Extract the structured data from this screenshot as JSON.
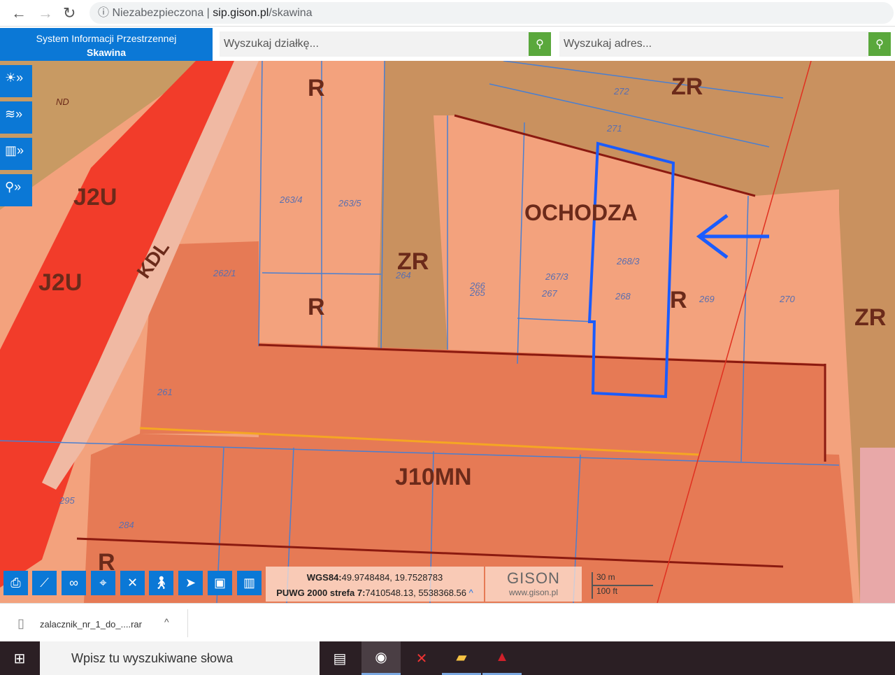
{
  "browser": {
    "security": "Niezabezpieczona",
    "url_host": "sip.gison.pl",
    "url_path": "/skawina"
  },
  "header": {
    "line1": "System Informacji Przestrzennej",
    "line2": "Skawina"
  },
  "search": {
    "parcel_placeholder": "Wyszukaj działkę...",
    "address_placeholder": "Wyszukaj adres..."
  },
  "map": {
    "zone_labels": [
      "R",
      "ZR",
      "J2U",
      "J2U",
      "KDL",
      "R",
      "ZR",
      "R",
      "R",
      "ZR",
      "J10MN",
      "R",
      "ZR",
      "ND"
    ],
    "place_label": "OCHODZA",
    "parcels": [
      "272",
      "271",
      "263/4",
      "263/5",
      "266",
      "265",
      "267/3",
      "267",
      "268/3",
      "268",
      "269",
      "270",
      "262/1",
      "261",
      "264",
      "295",
      "284"
    ],
    "highlight_color": "#1a5cff"
  },
  "coords": {
    "wgs_label": "WGS84:",
    "wgs_value": "49.9748484, 19.7528783",
    "puwg_label": "PUWG 2000 strefa 7:",
    "puwg_value": "7410548.13, 5538368.56"
  },
  "logo": {
    "name": "GISON",
    "url": "www.gison.pl"
  },
  "scale": {
    "metric": "30 m",
    "imperial": "100 ft"
  },
  "download": {
    "filename": "zalacznik_nr_1_do_....rar"
  },
  "taskbar": {
    "search_placeholder": "Wpisz tu wyszukiwane słowa"
  }
}
